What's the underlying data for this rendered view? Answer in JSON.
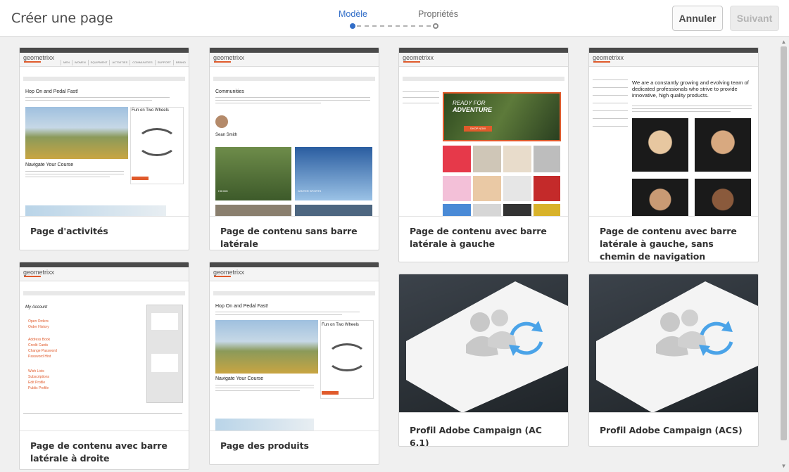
{
  "header": {
    "title": "Créer une page",
    "steps": [
      {
        "label": "Modèle"
      },
      {
        "label": "Propriétés"
      }
    ],
    "cancel_label": "Annuler",
    "next_label": "Suivant"
  },
  "templates": [
    {
      "title": "Page d'activités"
    },
    {
      "title": "Page de contenu sans barre latérale"
    },
    {
      "title": "Page de contenu avec barre latérale à gauche"
    },
    {
      "title": "Page de contenu avec barre latérale à gauche, sans chemin de navigation"
    },
    {
      "title": "Page de contenu avec barre latérale à droite"
    },
    {
      "title": "Page des produits"
    },
    {
      "title": "Profil Adobe Campaign (AC 6.1)"
    },
    {
      "title": "Profil Adobe Campaign (ACS)"
    }
  ],
  "thumbs": {
    "logo": "geometrixx",
    "nav": [
      "MEN",
      "WOMEN",
      "EQUIPMENT",
      "ACTIVITIES",
      "COMMUNITIES",
      "SUPPORT",
      "BRAND"
    ],
    "activities": {
      "heading": "Hop On and Pedal Fast!",
      "side_heading": "Fun on Two Wheels",
      "sub_heading": "Navigate Your Course"
    },
    "community": {
      "heading": "Communities",
      "person": "Sean Smith",
      "tile1": "HIKING",
      "tile2": "WINTER SPORTS"
    },
    "left_sidebar": {
      "banner1": "READY FOR",
      "banner2": "ADVENTURE",
      "shop": "SHOP NOW"
    },
    "no_breadcrumb": {
      "heading": "We are a constantly growing and evolving team of dedicated professionals who strive to provide innovative, high quality products."
    },
    "right_sidebar": {
      "heading": "My Account",
      "links": [
        "Open Orders",
        "Order History",
        "Address Book",
        "Credit Cards",
        "Change Password",
        "Password Hint",
        "Wish Lists",
        "Subscriptions",
        "Edit Profile",
        "Public Profile"
      ]
    },
    "products": {
      "heading": "Hop On and Pedal Fast!",
      "side_heading": "Fun on Two Wheels",
      "sub_heading": "Navigate Your Course"
    }
  },
  "colors": {
    "accent": "#326ec8",
    "brand_orange": "#e05a2b",
    "sync_blue": "#4aa3e8"
  }
}
